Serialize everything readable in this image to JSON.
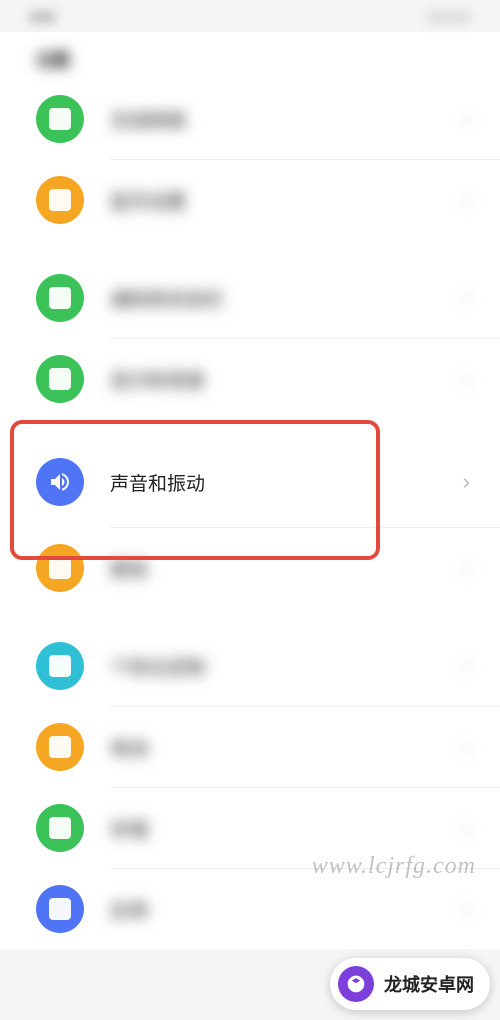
{
  "highlighted": {
    "label": "声音和振动",
    "icon": "speaker-icon"
  },
  "section1_header": "设置",
  "items_a": [
    {
      "color": "green",
      "label": "无线网络"
    },
    {
      "color": "orange",
      "label": "蓝牙设置"
    }
  ],
  "items_b": [
    {
      "color": "green",
      "label": "通知和状态栏"
    },
    {
      "color": "green",
      "label": "显示和亮度"
    }
  ],
  "items_c": [
    {
      "color": "orange",
      "label": "壁纸"
    }
  ],
  "items_d": [
    {
      "color": "cyan",
      "label": "个性化定制"
    },
    {
      "color": "orange",
      "label": "电池"
    },
    {
      "color": "green",
      "label": "存储"
    },
    {
      "color": "blue",
      "label": "应用"
    }
  ],
  "watermark": "www.lcjrfg.com",
  "logo_text": "龙城安卓网"
}
